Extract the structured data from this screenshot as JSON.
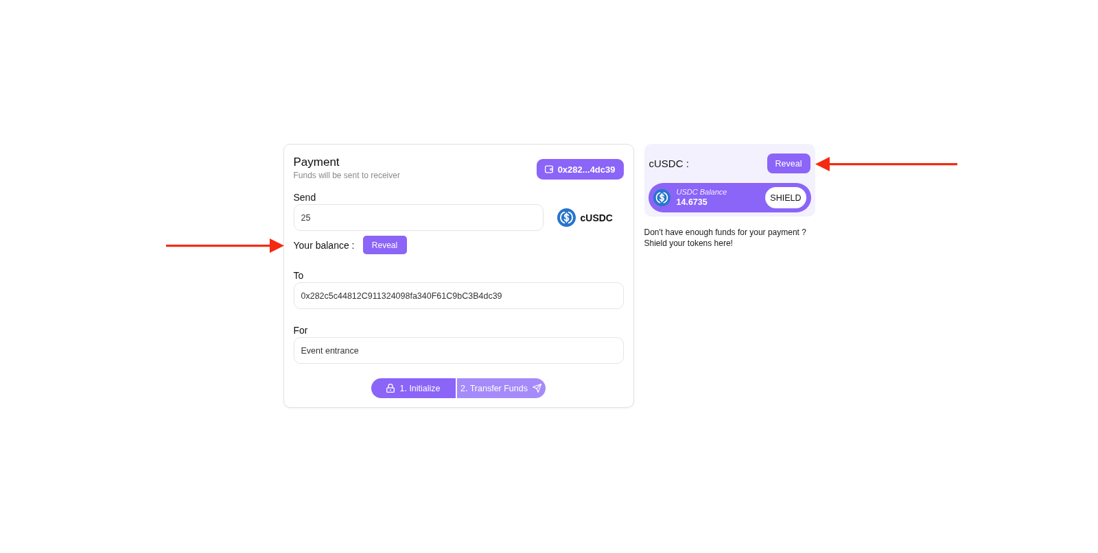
{
  "payment_card": {
    "title": "Payment",
    "subtitle": "Funds will be sent to receiver",
    "wallet_button": {
      "label": "0x282...4dc39"
    },
    "send": {
      "label": "Send",
      "value": "25",
      "token": "cUSDC"
    },
    "balance": {
      "label": "Your balance :",
      "button": "Reveal"
    },
    "to": {
      "label": "To",
      "value": "0x282c5c44812C911324098fa340F61C9bC3B4dc39"
    },
    "for": {
      "label": "For",
      "value": "Event entrance"
    },
    "actions": [
      {
        "label": "1. Initialize",
        "disabled": false
      },
      {
        "label": "2. Transfer Funds",
        "disabled": true
      }
    ]
  },
  "shield_panel": {
    "title": "cUSDC :",
    "reveal_button": "Reveal",
    "balance_label": "USDC Balance",
    "balance": "14.6735",
    "shield_button": "SHIELD",
    "note": "Don't have enough funds for your payment ?\nShield your tokens here!"
  }
}
